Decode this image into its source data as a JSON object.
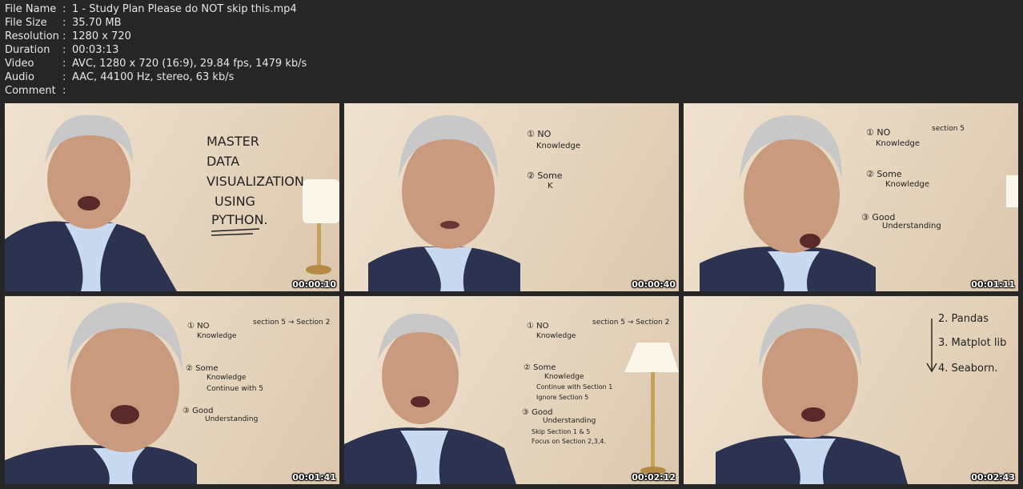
{
  "info": [
    {
      "key": "File Name",
      "value": "1 - Study Plan Please do NOT skip this.mp4"
    },
    {
      "key": "File Size",
      "value": "35.70 MB"
    },
    {
      "key": "Resolution",
      "value": "1280 x 720"
    },
    {
      "key": "Duration",
      "value": "00:03:13"
    },
    {
      "key": "Video",
      "value": "AVC, 1280 x 720 (16:9), 29.84 fps, 1479 kb/s"
    },
    {
      "key": "Audio",
      "value": "AAC, 44100 Hz, stereo, 63 kb/s"
    },
    {
      "key": "Comment",
      "value": ""
    }
  ],
  "separator": ":",
  "thumbnails": [
    {
      "timestamp": "00:00:10",
      "board": [
        "MASTER",
        "DATA",
        "VISUALIZATION",
        "USING",
        "PYTHON."
      ]
    },
    {
      "timestamp": "00:00:40",
      "board": [
        "① NO",
        "Knowledge",
        "② Some",
        "K"
      ]
    },
    {
      "timestamp": "00:01:11",
      "board": [
        "① NO",
        "Knowledge",
        "section 5",
        "② Some",
        "Knowledge",
        "③ Good",
        "Understanding"
      ]
    },
    {
      "timestamp": "00:01:41",
      "board": [
        "① NO",
        "Knowledge",
        "section 5 → Section 2",
        "② Some",
        "Knowledge",
        "Continue with 5",
        "③ Good",
        "Understanding"
      ]
    },
    {
      "timestamp": "00:02:12",
      "board": [
        "① NO",
        "Knowledge",
        "section 5 → Section 2",
        "② Some",
        "Knowledge",
        "Continue with Section 1",
        "Ignore Section 5",
        "③ Good",
        "Understanding",
        "Skip Section 1 & 5",
        "Focus on Section 2,3,4."
      ]
    },
    {
      "timestamp": "00:02:43",
      "board": [
        "2. Pandas",
        "3. Matplot lib",
        "4. Seaborn."
      ]
    }
  ],
  "colors": {
    "background": "#262626",
    "text": "#e6e6e6",
    "wall": "#e8d8c2",
    "suit": "#2b3350",
    "shirt": "#c9daf0",
    "skin": "#c99a7e",
    "hair": "#c8c8c8"
  }
}
